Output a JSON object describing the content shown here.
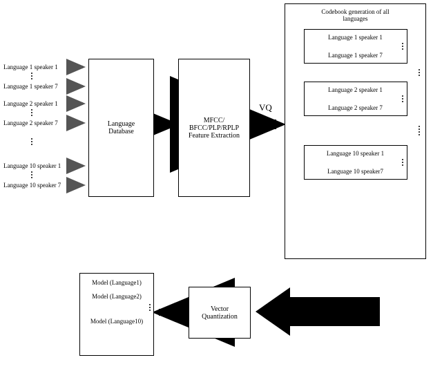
{
  "inputs": {
    "l1s1": "Language 1 speaker 1",
    "l1s7": "Language 1 speaker 7",
    "l2s1": "Language 2 speaker 1",
    "l2s7": "Language 2 speaker 7",
    "l10s1": "Language 10 speaker 1",
    "l10s7": "Language 10 speaker 7"
  },
  "blocks": {
    "database": "Language\nDatabase",
    "feature": "MFCC/\nBFCC/PLP/RPLP\nFeature Extraction",
    "vq_label": "VQ",
    "codebook_title": "Codebook generation of all\nlanguages",
    "cb1_a": "Language 1 speaker 1",
    "cb1_b": "Language 1 speaker 7",
    "cb2_a": "Language 2 speaker 1",
    "cb2_b": "Language 2 speaker 7",
    "cb10_a": "Language 10 speaker 1",
    "cb10_b": "Language 10 speaker7",
    "vector_quant": "Vector\nQuantization",
    "model1": "Model (Language1)",
    "model2": "Model (Language2)",
    "model10": "Model (Language10)"
  }
}
